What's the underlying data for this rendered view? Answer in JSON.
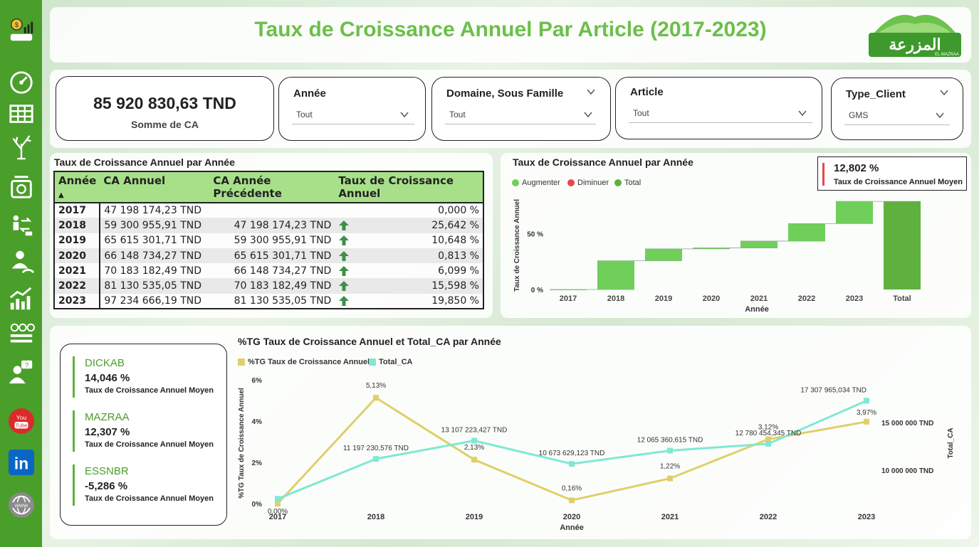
{
  "header": {
    "title": "Taux de Croissance Annuel Par Article (2017-2023)",
    "logo_text": "المزرعة",
    "logo_sub": "EL MAZRAA"
  },
  "sidebar": {
    "icons": [
      "money-chart-icon",
      "gauge-icon",
      "table-icon",
      "tree-icon",
      "scale-icon",
      "transfer-icon",
      "performance-icon",
      "growth-chart-icon",
      "dashboard-grid-icon",
      "help-user-icon",
      "youtube-icon",
      "linkedin-icon",
      "web-icon"
    ]
  },
  "kpi": {
    "value": "85 920 830,63 TND",
    "label": "Somme de CA"
  },
  "filters": [
    {
      "title": "Année",
      "value": "Tout"
    },
    {
      "title": "Domaine, Sous Famille",
      "value": "Tout"
    },
    {
      "title": "Article",
      "value": "Tout"
    },
    {
      "title": "Type_Client",
      "value": "GMS"
    }
  ],
  "table": {
    "title": "Taux de Croissance Annuel par Année",
    "headers": [
      "Année",
      "CA Annuel",
      "CA Année Précédente",
      "Taux de Croissance Annuel"
    ],
    "rows": [
      {
        "year": "2017",
        "ca": "47 198 174,23 TND",
        "prev": "",
        "rate": "0,000 %",
        "up": false
      },
      {
        "year": "2018",
        "ca": "59 300 955,91 TND",
        "prev": "47 198 174,23 TND",
        "rate": "25,642 %",
        "up": true
      },
      {
        "year": "2019",
        "ca": "65 615 301,71 TND",
        "prev": "59 300 955,91 TND",
        "rate": "10,648 %",
        "up": true
      },
      {
        "year": "2020",
        "ca": "66 148 734,27 TND",
        "prev": "65 615 301,71 TND",
        "rate": "0,813 %",
        "up": true
      },
      {
        "year": "2021",
        "ca": "70 183 182,49 TND",
        "prev": "66 148 734,27 TND",
        "rate": "6,099 %",
        "up": true
      },
      {
        "year": "2022",
        "ca": "81 130 535,05 TND",
        "prev": "70 183 182,49 TND",
        "rate": "15,598 %",
        "up": true
      },
      {
        "year": "2023",
        "ca": "97 234 666,19 TND",
        "prev": "81 130 535,05 TND",
        "rate": "19,850 %",
        "up": true
      }
    ]
  },
  "waterfall": {
    "title": "Taux de Croissance Annuel par Année",
    "legend": [
      {
        "name": "Augmenter",
        "color": "#6fcf5a"
      },
      {
        "name": "Diminuer",
        "color": "#e5484d"
      },
      {
        "name": "Total",
        "color": "#5fb13f"
      }
    ],
    "avg_value": "12,802 %",
    "avg_label": "Taux de Croissance Annuel Moyen"
  },
  "brands": [
    {
      "name": "DICKAB",
      "value": "14,046 %",
      "label": "Taux de Croissance Annuel Moyen"
    },
    {
      "name": "MAZRAA",
      "value": "12,307 %",
      "label": "Taux de Croissance Annuel Moyen"
    },
    {
      "name": "ESSNBR",
      "value": "-5,286 %",
      "label": "Taux de Croissance Annuel Moyen"
    }
  ],
  "line_chart": {
    "title": "%TG Taux de Croissance Annuel et Total_CA par Année",
    "legend": [
      {
        "name": "%TG Taux de Croissance Annuel",
        "color": "#e0cf6a"
      },
      {
        "name": "Total_CA",
        "color": "#7fe8d4"
      }
    ]
  },
  "chart_data": [
    {
      "type": "bar",
      "subtype": "waterfall",
      "title": "Taux de Croissance Annuel par Année",
      "xlabel": "Année",
      "ylabel": "Taux de Croissance Annuel",
      "categories": [
        "2017",
        "2018",
        "2019",
        "2020",
        "2021",
        "2022",
        "2023",
        "Total"
      ],
      "values": [
        0.0,
        25.642,
        10.648,
        0.813,
        6.099,
        15.598,
        19.85,
        78.65
      ],
      "y_ticks": [
        "0 %",
        "50 %"
      ],
      "ylim": [
        0,
        90
      ],
      "legend": [
        "Augmenter",
        "Diminuer",
        "Total"
      ],
      "legend_position": "top-left"
    },
    {
      "type": "line",
      "title": "%TG Taux de Croissance Annuel et Total_CA par Année",
      "xlabel": "Année",
      "ylabel": "%TG Taux de Croissance Annuel",
      "y2label": "Total_CA",
      "categories": [
        "2017",
        "2018",
        "2019",
        "2020",
        "2021",
        "2022",
        "2023"
      ],
      "series": [
        {
          "name": "%TG Taux de Croissance Annuel",
          "axis": "left",
          "values": [
            0.0,
            5.13,
            2.13,
            0.16,
            1.22,
            3.12,
            3.97
          ],
          "labels": [
            "0,00%",
            "5,13%",
            "2,13%",
            "0,16%",
            "1,22%",
            "3,12%",
            "3,97%"
          ]
        },
        {
          "name": "Total_CA",
          "axis": "right",
          "values": [
            7000000,
            11197230.576,
            13107223.427,
            10673629.123,
            12065360.615,
            12780454.345,
            17307965.034
          ],
          "labels": [
            "",
            "11 197 230,576 TND",
            "13 107 223,427 TND",
            "10 673 629,123 TND",
            "12 065 360,615 TND",
            "12 780 454,345 TND",
            "17 307 965,034 TND"
          ]
        }
      ],
      "y_ticks": [
        "0%",
        "2%",
        "4%",
        "6%"
      ],
      "ylim": [
        0,
        6
      ],
      "y2_ticks": [
        "10 000 000 TND",
        "15 000 000 TND"
      ],
      "y2lim": [
        6500000,
        19500000
      ],
      "legend_position": "top-left"
    }
  ]
}
